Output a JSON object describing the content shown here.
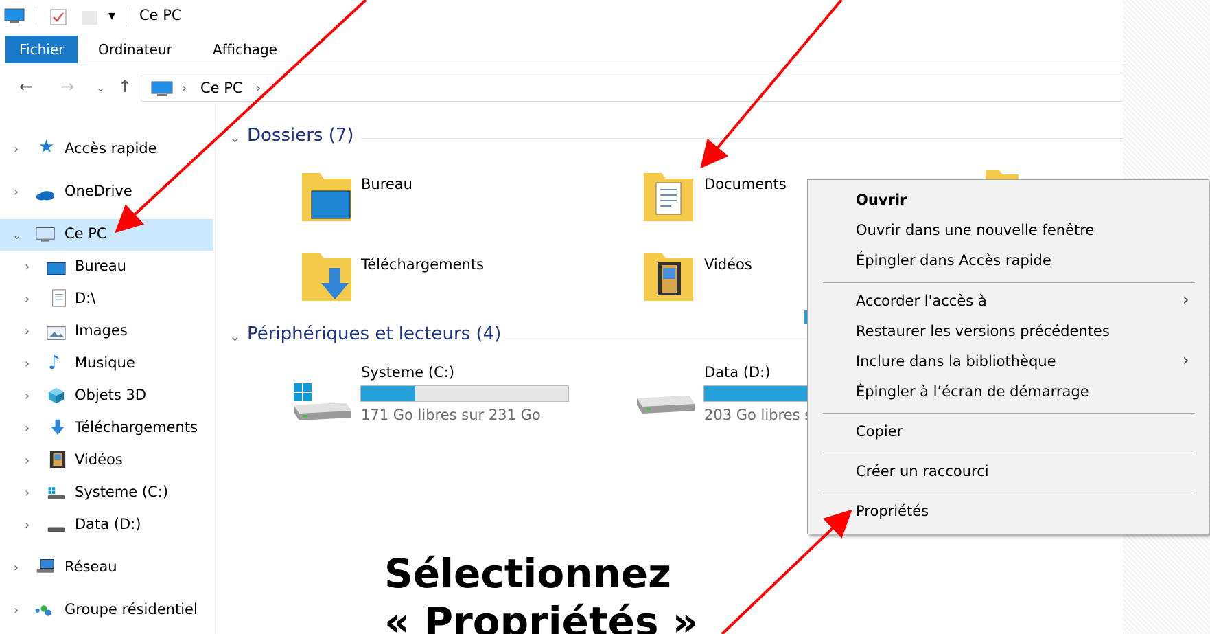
{
  "window": {
    "title": "Ce PC"
  },
  "ribbon": {
    "tabs": [
      "Fichier",
      "Ordinateur",
      "Affichage"
    ],
    "active": "Fichier"
  },
  "address": {
    "crumbs": [
      "Ce PC"
    ]
  },
  "sidebar": {
    "items": [
      {
        "label": "Accès rapide",
        "icon": "star-icon"
      },
      {
        "label": "OneDrive",
        "icon": "cloud-icon"
      },
      {
        "label": "Ce PC",
        "icon": "computer-icon",
        "selected": true
      },
      {
        "label": "Bureau",
        "icon": "desktop-icon"
      },
      {
        "label": "D:\\",
        "icon": "document-icon"
      },
      {
        "label": "Images",
        "icon": "pictures-icon"
      },
      {
        "label": "Musique",
        "icon": "music-icon"
      },
      {
        "label": "Objets 3D",
        "icon": "cube-icon"
      },
      {
        "label": "Téléchargements",
        "icon": "download-icon"
      },
      {
        "label": "Vidéos",
        "icon": "film-icon"
      },
      {
        "label": "Systeme (C:)",
        "icon": "windows-drive-icon"
      },
      {
        "label": "Data (D:)",
        "icon": "drive-icon"
      },
      {
        "label": "Réseau",
        "icon": "network-icon"
      },
      {
        "label": "Groupe résidentiel",
        "icon": "homegroup-icon"
      }
    ]
  },
  "folders": {
    "header": "Dossiers (7)",
    "items": [
      {
        "label": "Bureau",
        "icon": "desktop-folder-icon"
      },
      {
        "label": "Documents",
        "icon": "documents-folder-icon"
      },
      {
        "label": "Téléchargements",
        "icon": "downloads-folder-icon"
      },
      {
        "label": "Vidéos",
        "icon": "videos-folder-icon"
      }
    ]
  },
  "devices": {
    "header": "Périphériques et lecteurs (4)",
    "items": [
      {
        "label": "Systeme (C:)",
        "free_text": "171 Go libres sur 231 Go",
        "used_fraction": 0.26
      },
      {
        "label": "Data (D:)",
        "free_text": "203 Go libres s",
        "used_fraction": 0.5
      }
    ]
  },
  "context_menu": {
    "items": [
      "Ouvrir",
      "Ouvrir dans une nouvelle fenêtre",
      "Épingler dans Accès rapide",
      "Accorder l'accès à",
      "Restaurer les versions précédentes",
      "Inclure dans la bibliothèque",
      "Épingler à l’écran de démarrage",
      "Copier",
      "Créer un raccourci",
      "Propriétés"
    ]
  },
  "annotation": {
    "line1": "Sélectionnez",
    "line2": "« Propriétés »",
    "color": "#ff0000"
  },
  "colors": {
    "accent": "#1979ca",
    "selection": "#cce8ff",
    "bar": "#26a0da",
    "header": "#1e3287"
  }
}
